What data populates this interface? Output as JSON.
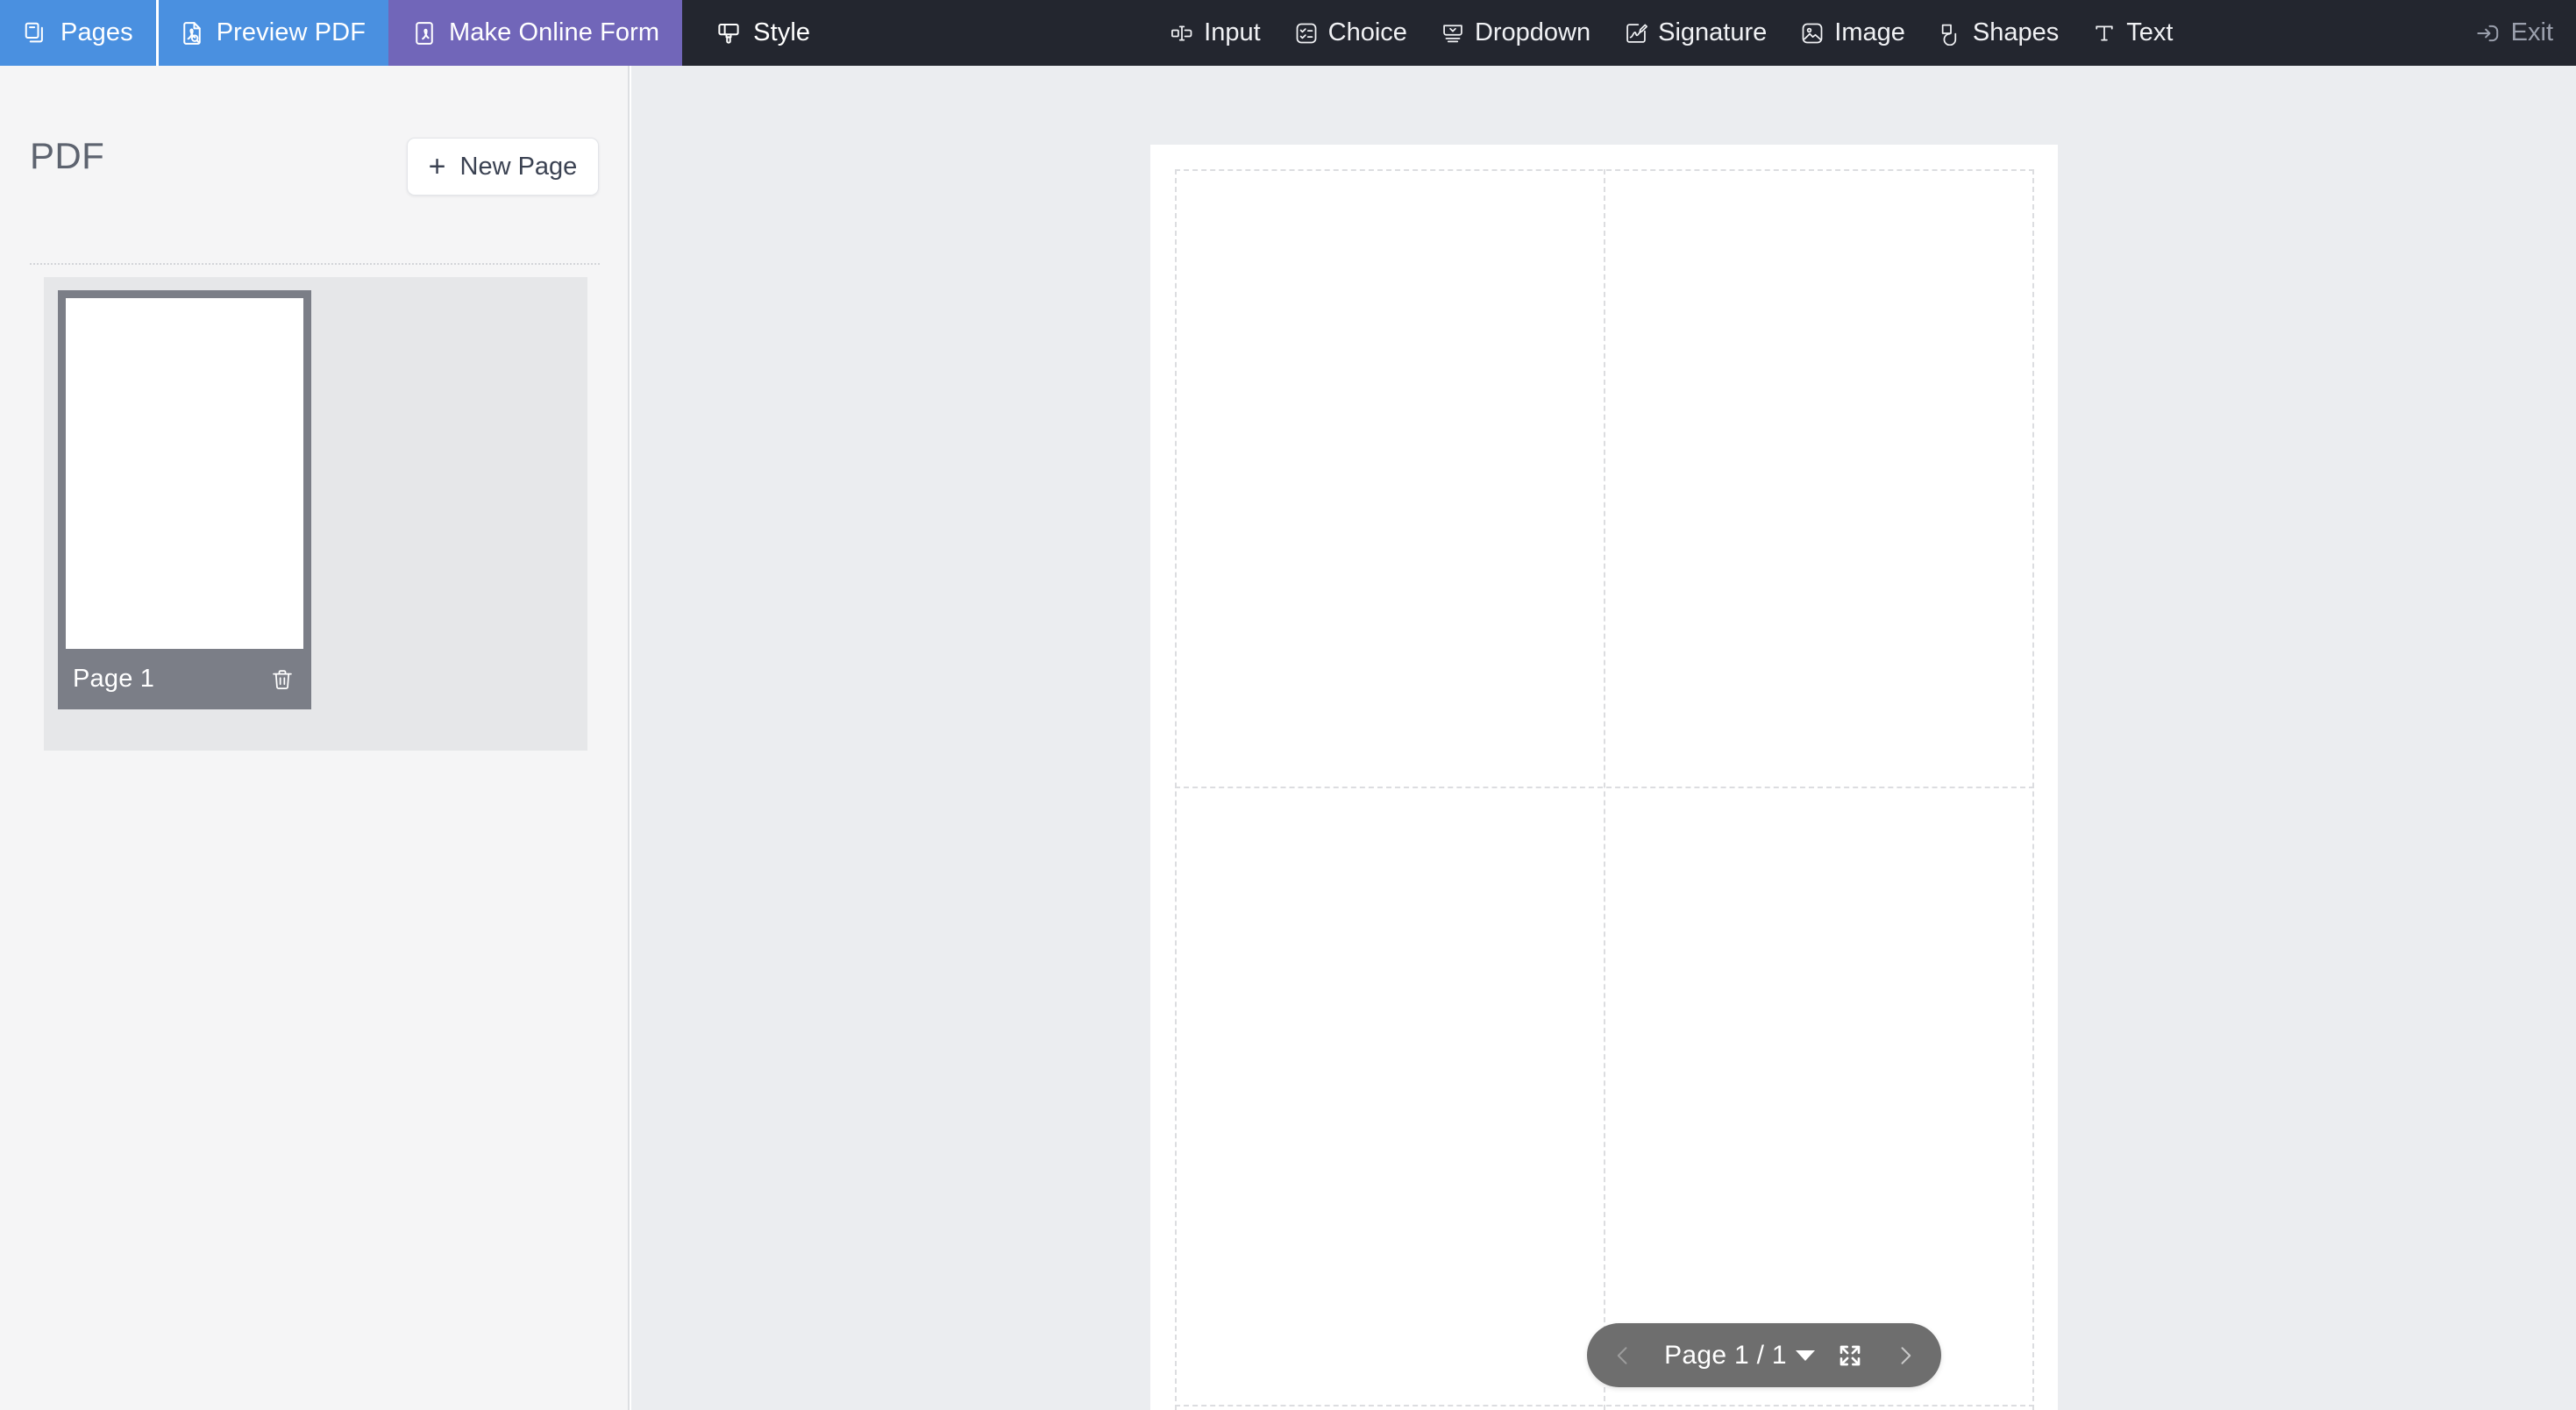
{
  "topbar": {
    "nav_tabs": [
      {
        "label": "Pages",
        "icon": "pages-icon",
        "state": "blue"
      },
      {
        "label": "Preview PDF",
        "icon": "preview-pdf-icon",
        "state": "blue"
      },
      {
        "label": "Make Online Form",
        "icon": "make-online-form-icon",
        "state": "purple"
      },
      {
        "label": "Style",
        "icon": "style-brush-icon",
        "state": "dark"
      }
    ],
    "tools": [
      {
        "label": "Input",
        "icon": "input-field-icon"
      },
      {
        "label": "Choice",
        "icon": "checklist-icon"
      },
      {
        "label": "Dropdown",
        "icon": "dropdown-icon"
      },
      {
        "label": "Signature",
        "icon": "signature-icon"
      },
      {
        "label": "Image",
        "icon": "image-icon"
      },
      {
        "label": "Shapes",
        "icon": "shapes-icon"
      },
      {
        "label": "Text",
        "icon": "text-icon"
      }
    ],
    "exit": {
      "label": "Exit",
      "icon": "exit-icon"
    }
  },
  "sidebar": {
    "title": "PDF",
    "new_page": {
      "label": "New Page",
      "plus": "+"
    },
    "pages": [
      {
        "label": "Page 1",
        "selected": true,
        "delete_icon": "trash-icon"
      }
    ]
  },
  "pager": {
    "prev_icon": "chevron-left-icon",
    "next_icon": "chevron-right-icon",
    "label": "Page 1 / 1",
    "caret_icon": "caret-down-icon",
    "expand_icon": "fullscreen-icon"
  },
  "colors": {
    "toolbar_dark": "#23262f",
    "tab_blue": "#4a90e0",
    "tab_purple": "#7166b9",
    "sidebar_bg": "#f5f5f6",
    "canvas_bg": "#ebedf0",
    "card_gray": "#7b7e87",
    "pager_gray": "#6e6e6e"
  }
}
